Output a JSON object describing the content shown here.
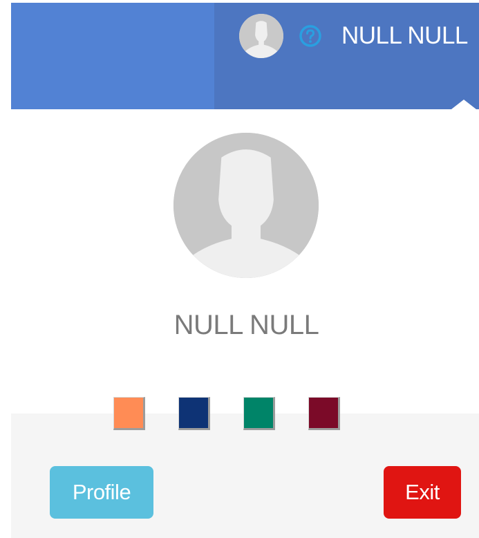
{
  "navbar": {
    "left_color": "#5282d4",
    "right_color": "#4d76c1",
    "avatar_icon": "user-avatar-icon",
    "help_icon": "help-circle-icon",
    "help_color": "#2a9fe0",
    "username": "NULL NULL"
  },
  "dropdown": {
    "avatar_icon": "user-avatar-icon",
    "username": "NULL NULL",
    "theme_swatches": [
      {
        "name": "orange",
        "color": "#ff8c55"
      },
      {
        "name": "navy",
        "color": "#0e3375"
      },
      {
        "name": "teal",
        "color": "#008468"
      },
      {
        "name": "maroon",
        "color": "#7b0a28"
      }
    ],
    "profile_label": "Profile",
    "profile_color": "#5bc0de",
    "exit_label": "Exit",
    "exit_color": "#e01512"
  }
}
